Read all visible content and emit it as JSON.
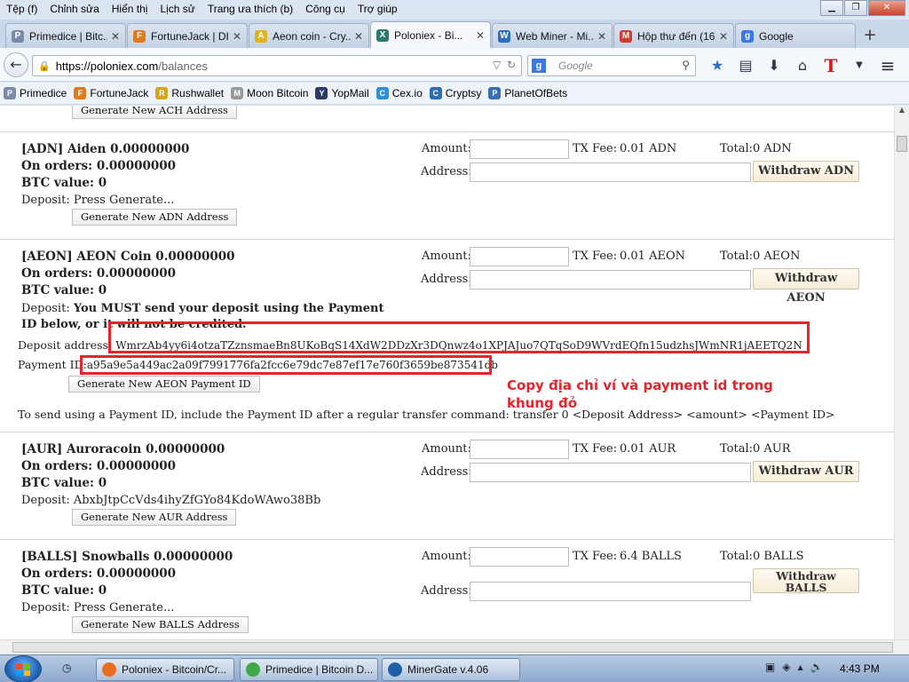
{
  "menu": [
    "Tệp (f)",
    "Chỉnh sửa",
    "Hiển thị",
    "Lịch sử",
    "Trang ưa thích (b)",
    "Công cụ",
    "Trợ giúp"
  ],
  "tabs": [
    {
      "label": "Primedice | Bitc...",
      "color": "#7a8aa8",
      "icon": "P"
    },
    {
      "label": "FortuneJack | DI...",
      "color": "#e07b1d",
      "icon": "F"
    },
    {
      "label": "Aeon coin - Cry...",
      "color": "#e0b21d",
      "icon": "A"
    },
    {
      "label": "Poloniex - Bi...",
      "color": "#2c7a6e",
      "icon": "X"
    },
    {
      "label": "Web Miner - Mi...",
      "color": "#2a6ec0",
      "icon": "W"
    },
    {
      "label": "Hộp thư đến (16...",
      "color": "#d23b2e",
      "icon": "M"
    },
    {
      "label": "Google",
      "color": "#3b78e7",
      "icon": "g"
    }
  ],
  "url": {
    "host": "https://poloniex.com",
    "path": "/balances"
  },
  "search_placeholder": "Google",
  "bookmarks": [
    {
      "label": "Primedice",
      "color": "#7a8aa8",
      "icon": "P"
    },
    {
      "label": "FortuneJack",
      "color": "#e07b1d",
      "icon": "F"
    },
    {
      "label": "Rushwallet",
      "color": "#d6a51c",
      "icon": "R"
    },
    {
      "label": "Moon Bitcoin",
      "color": "#999999",
      "icon": "M"
    },
    {
      "label": "YopMail",
      "color": "#2b3a67",
      "icon": "Y"
    },
    {
      "label": "Cex.io",
      "color": "#2f8fd6",
      "icon": "C"
    },
    {
      "label": "Cryptsy",
      "color": "#2f6db3",
      "icon": "C"
    },
    {
      "label": "PlanetOfBets",
      "color": "#3a6fb0",
      "icon": "P"
    }
  ],
  "labels": {
    "amount": "Amount:",
    "tx_fee": "TX Fee:",
    "total": "Total:",
    "address": "Address:",
    "deposit": "Deposit:"
  },
  "ach_button": "Generate New ACH Address",
  "coins": {
    "adn": {
      "title": "[ADN] Aiden 0.00000000",
      "on_orders": "On orders: 0.00000000",
      "btc_value": "BTC value: 0",
      "deposit": "Press Generate...",
      "gen_button": "Generate New ADN Address",
      "fee": "0.01 ADN",
      "total": "0 ADN",
      "withdraw": "Withdraw ADN"
    },
    "aeon": {
      "title": "[AEON] AEON Coin 0.00000000",
      "on_orders": "On orders: 0.00000000",
      "btc_value": "BTC value: 0",
      "deposit_warning": "You MUST send your deposit using the Payment ID below, or it will not be credited.",
      "deposit_address_label": "Deposit address:",
      "deposit_address": "WmrzAb4yy6i4otzaTZznsmaeBn8UKoBqS14XdW2DDzXr3DQnwz4o1XPJAJuo7QTqSoD9WVrdEQfn15udzhsJWmNR1jAEETQ2N",
      "payment_id_label": "Payment ID:",
      "payment_id": "a95a9e5a449ac2a09f7991776fa2fcc6e79dc7e87ef17e760f3659be873541db",
      "gen_button": "Generate New AEON Payment ID",
      "fee": "0.01 AEON",
      "total": "0 AEON",
      "withdraw": "Withdraw AEON"
    },
    "aur": {
      "title": "[AUR] Auroracoin 0.00000000",
      "on_orders": "On orders: 0.00000000",
      "btc_value": "BTC value: 0",
      "deposit": "AbxbJtpCcVds4ihyZfGYo84KdoWAwo38Bb",
      "gen_button": "Generate New AUR Address",
      "fee": "0.01 AUR",
      "total": "0 AUR",
      "withdraw": "Withdraw AUR"
    },
    "balls": {
      "title": "[BALLS] Snowballs 0.00000000",
      "on_orders": "On orders: 0.00000000",
      "btc_value": "BTC value: 0",
      "deposit": "Press Generate...",
      "gen_button": "Generate New BALLS Address",
      "fee": "6.4 BALLS",
      "total": "0 BALLS",
      "withdraw": "Withdraw BALLS"
    }
  },
  "payment_note": "To send using a Payment ID, include the Payment ID after a regular transfer command:  transfer 0 <Deposit Address> <amount> <Payment ID>",
  "annotation": "Copy địa chỉ ví và payment id trong khung đỏ",
  "taskbar": [
    {
      "label": "Poloniex - Bitcoin/Cr...",
      "color": "#e86d1f"
    },
    {
      "label": "Primedice | Bitcoin D...",
      "color": "#3ea84a"
    },
    {
      "label": "MinerGate v.4.06",
      "color": "#1f5fa8"
    }
  ],
  "clock": "4:43 PM",
  "colors": {
    "annotation_red": "#e8232b",
    "withdraw_bg": "#f8f0dd"
  }
}
